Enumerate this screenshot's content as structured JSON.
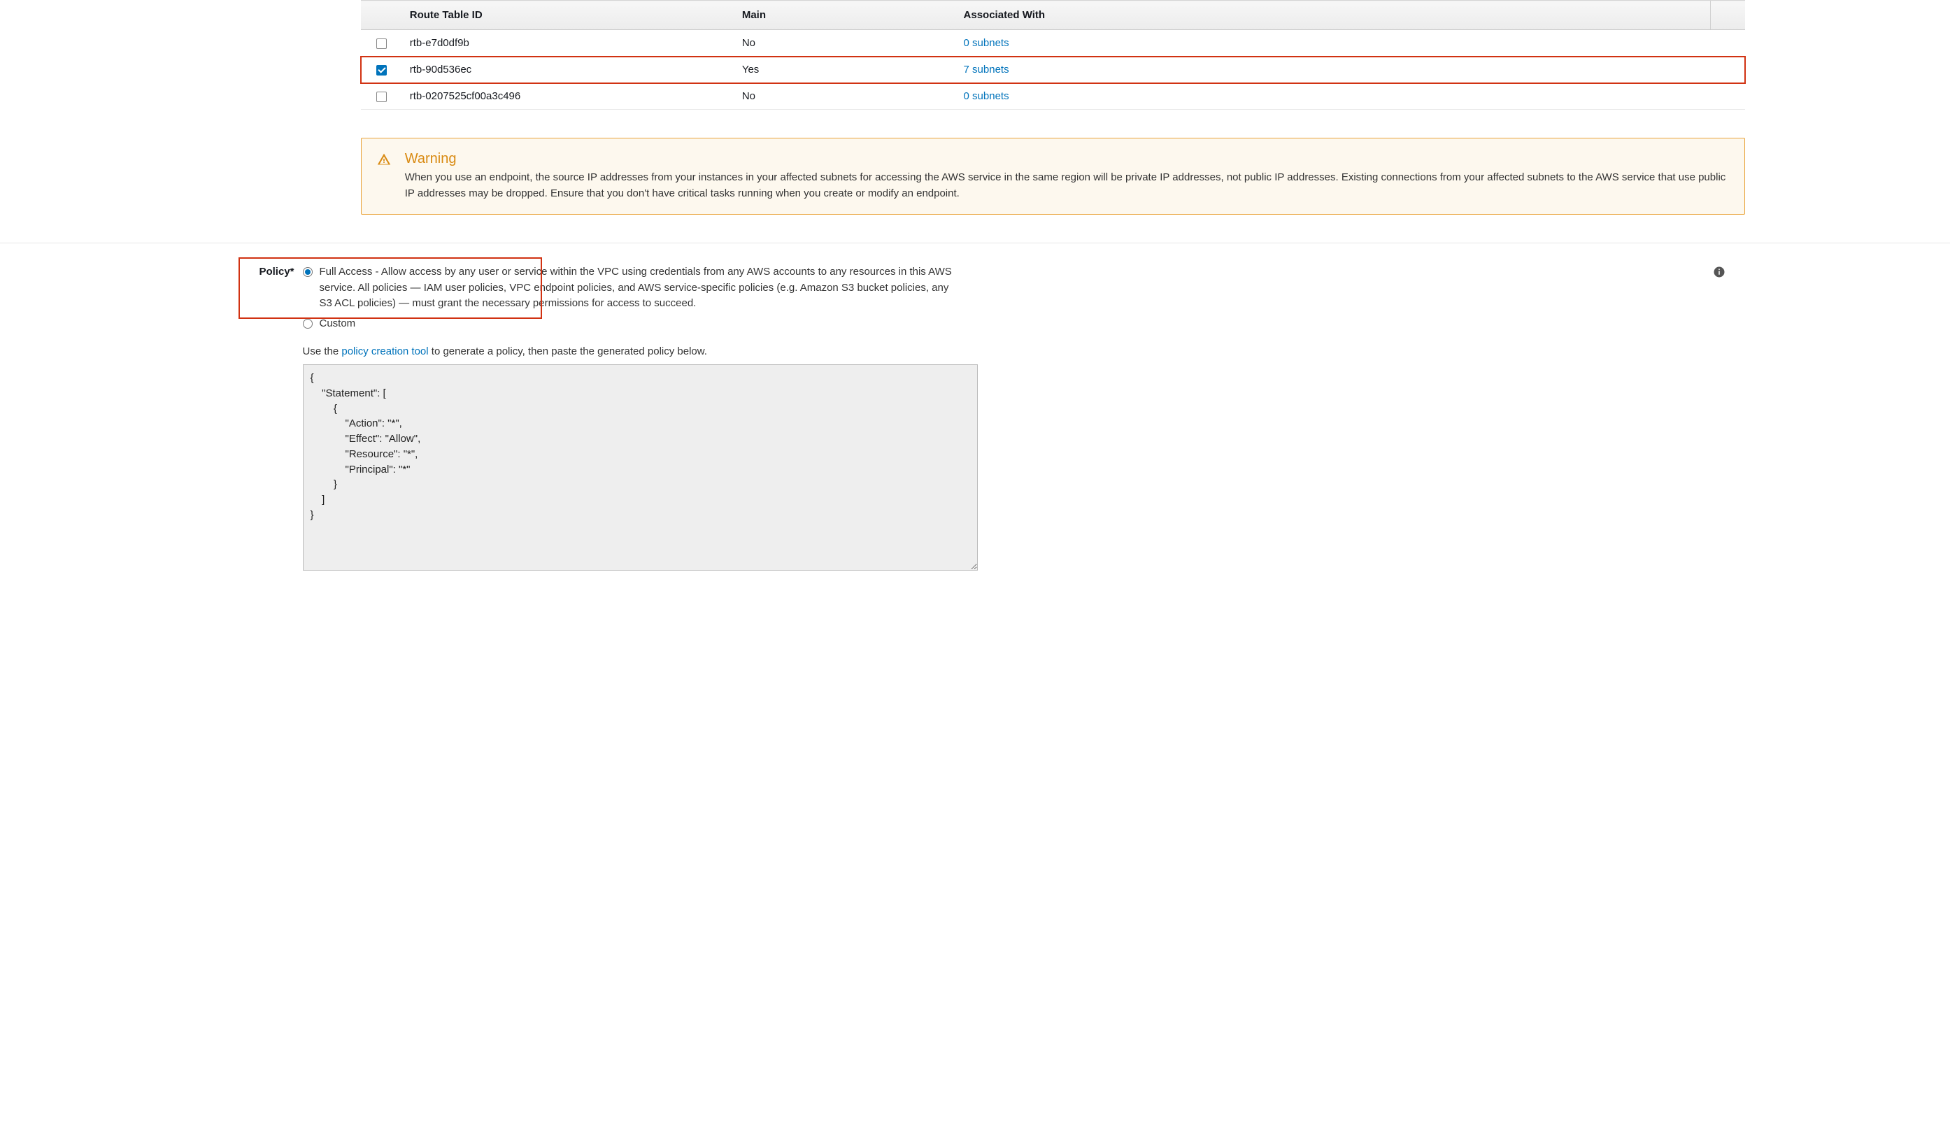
{
  "table": {
    "headers": {
      "id": "Route Table ID",
      "main": "Main",
      "assoc": "Associated With"
    },
    "rows": [
      {
        "id": "rtb-e7d0df9b",
        "main": "No",
        "assoc": "0 subnets",
        "checked": false,
        "highlight": false
      },
      {
        "id": "rtb-90d536ec",
        "main": "Yes",
        "assoc": "7 subnets",
        "checked": true,
        "highlight": true
      },
      {
        "id": "rtb-0207525cf00a3c496",
        "main": "No",
        "assoc": "0 subnets",
        "checked": false,
        "highlight": false
      }
    ]
  },
  "warning": {
    "title": "Warning",
    "text": "When you use an endpoint, the source IP addresses from your instances in your affected subnets for accessing the AWS service in the same region will be private IP addresses, not public IP addresses. Existing connections from your affected subnets to the AWS service that use public IP addresses may be dropped. Ensure that you don't have critical tasks running when you create or modify an endpoint."
  },
  "policy": {
    "label": "Policy*",
    "full_access_text": "Full Access - Allow access by any user or service within the VPC using credentials from any AWS accounts to any resources in this AWS service. All policies — IAM user policies, VPC endpoint policies, and AWS service-specific policies (e.g. Amazon S3 bucket policies, any S3 ACL policies) — must grant the necessary permissions for access to succeed.",
    "custom_text": "Custom",
    "hint_prefix": "Use the ",
    "hint_link": "policy creation tool",
    "hint_suffix": " to generate a policy, then paste the generated policy below.",
    "document": "{\n    \"Statement\": [\n        {\n            \"Action\": \"*\",\n            \"Effect\": \"Allow\",\n            \"Resource\": \"*\",\n            \"Principal\": \"*\"\n        }\n    ]\n}"
  }
}
